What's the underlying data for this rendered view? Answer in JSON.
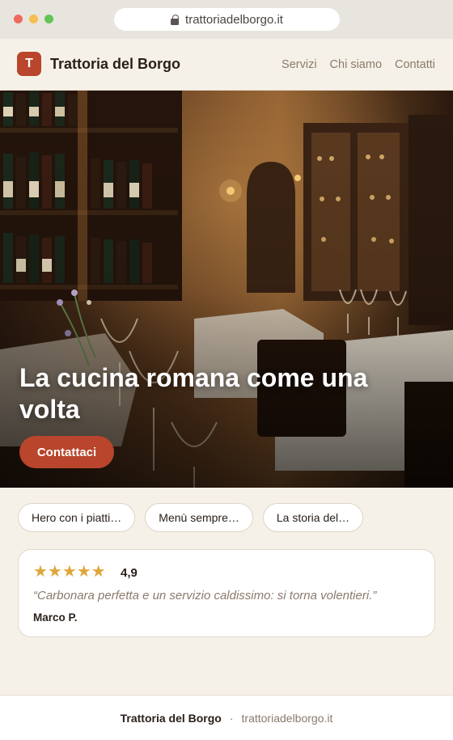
{
  "browser": {
    "url": "trattoriadelborgo.it"
  },
  "nav": {
    "logo_letter": "T",
    "brand": "Trattoria del Borgo",
    "links": [
      "Servizi",
      "Chi siamo",
      "Contatti"
    ]
  },
  "hero": {
    "title": "La cucina romana come una volta",
    "cta_label": "Contattaci"
  },
  "chips": [
    "Hero con i piatti…",
    "Menù sempre…",
    "La storia del…"
  ],
  "review": {
    "stars": "★★★★★",
    "star_count": 5,
    "rating": "4,9",
    "quote": "“Carbonara perfetta e un servizio caldissimo: si torna volentieri.”",
    "author": "Marco P."
  },
  "footer": {
    "brand": "Trattoria del Borgo",
    "separator": "·",
    "domain": "trattoriadelborgo.it"
  },
  "colors": {
    "accent": "#b8452c",
    "star": "#dea73b",
    "background": "#f6f1e8",
    "muted_text": "#8a7a6c"
  }
}
